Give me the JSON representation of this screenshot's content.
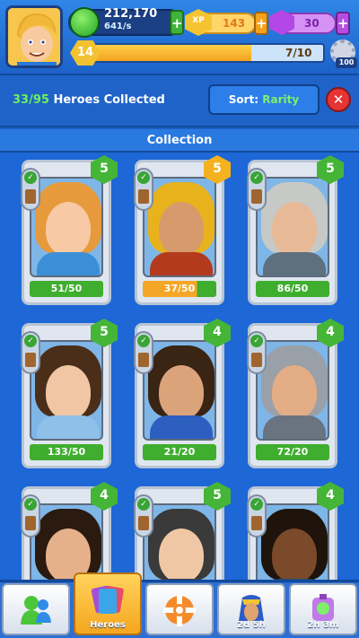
{
  "top": {
    "cash": "212,170",
    "cash_rate": "641/s",
    "xp": "143",
    "gems": "30",
    "level": "14",
    "level_progress_text": "7/10",
    "level_progress": 0.7,
    "settings_badge": "100",
    "plus": "+"
  },
  "header": {
    "collected_count": "33/95",
    "collected_label": "Heroes Collected",
    "sort_prefix": "Sort:",
    "sort_value": "Rarity",
    "close": "✕"
  },
  "section_title": "Collection",
  "cards": [
    {
      "stars": "5",
      "progress": "51/50",
      "star_color": "green",
      "bar": "green",
      "hair": "#e69a3c",
      "skin": "#f7c9a4",
      "body": "#3c8fd6"
    },
    {
      "stars": "5",
      "progress": "37/50",
      "star_color": "gold",
      "bar": "orange",
      "hair": "#e8b21c",
      "skin": "#d79a6c",
      "body": "#b33a1c"
    },
    {
      "stars": "5",
      "progress": "86/50",
      "star_color": "green",
      "bar": "green",
      "hair": "#c7c9c6",
      "skin": "#e7b996",
      "body": "#5e6f7d"
    },
    {
      "stars": "5",
      "progress": "133/50",
      "star_color": "green",
      "bar": "green",
      "hair": "#4a2e1a",
      "skin": "#f1c6a4",
      "body": "#8fc0ea"
    },
    {
      "stars": "4",
      "progress": "21/20",
      "star_color": "green",
      "bar": "green",
      "hair": "#3a2414",
      "skin": "#dba37a",
      "body": "#2c5fbf"
    },
    {
      "stars": "4",
      "progress": "72/20",
      "star_color": "green",
      "bar": "green",
      "hair": "#9aa0a8",
      "skin": "#e3ad86",
      "body": "#6a7380"
    },
    {
      "stars": "4",
      "progress": "",
      "star_color": "green",
      "bar": "green",
      "hair": "#2b1a10",
      "skin": "#e6b18a",
      "body": "#3a4a6a"
    },
    {
      "stars": "5",
      "progress": "",
      "star_color": "green",
      "bar": "green",
      "hair": "#3a3a3a",
      "skin": "#f0c7a4",
      "body": "#3a3f4a"
    },
    {
      "stars": "4",
      "progress": "",
      "star_color": "green",
      "bar": "green",
      "hair": "#1e140c",
      "skin": "#7a4a2a",
      "body": "#2a4a6a"
    }
  ],
  "tabs": [
    {
      "label": "",
      "icon": "people-icon"
    },
    {
      "label": "Heroes",
      "icon": "cards-icon"
    },
    {
      "label": "",
      "icon": "lifebuoy-icon"
    },
    {
      "label": "2d 5h",
      "icon": "pharaoh-icon"
    },
    {
      "label": "2h 3m",
      "icon": "pod-icon"
    }
  ]
}
